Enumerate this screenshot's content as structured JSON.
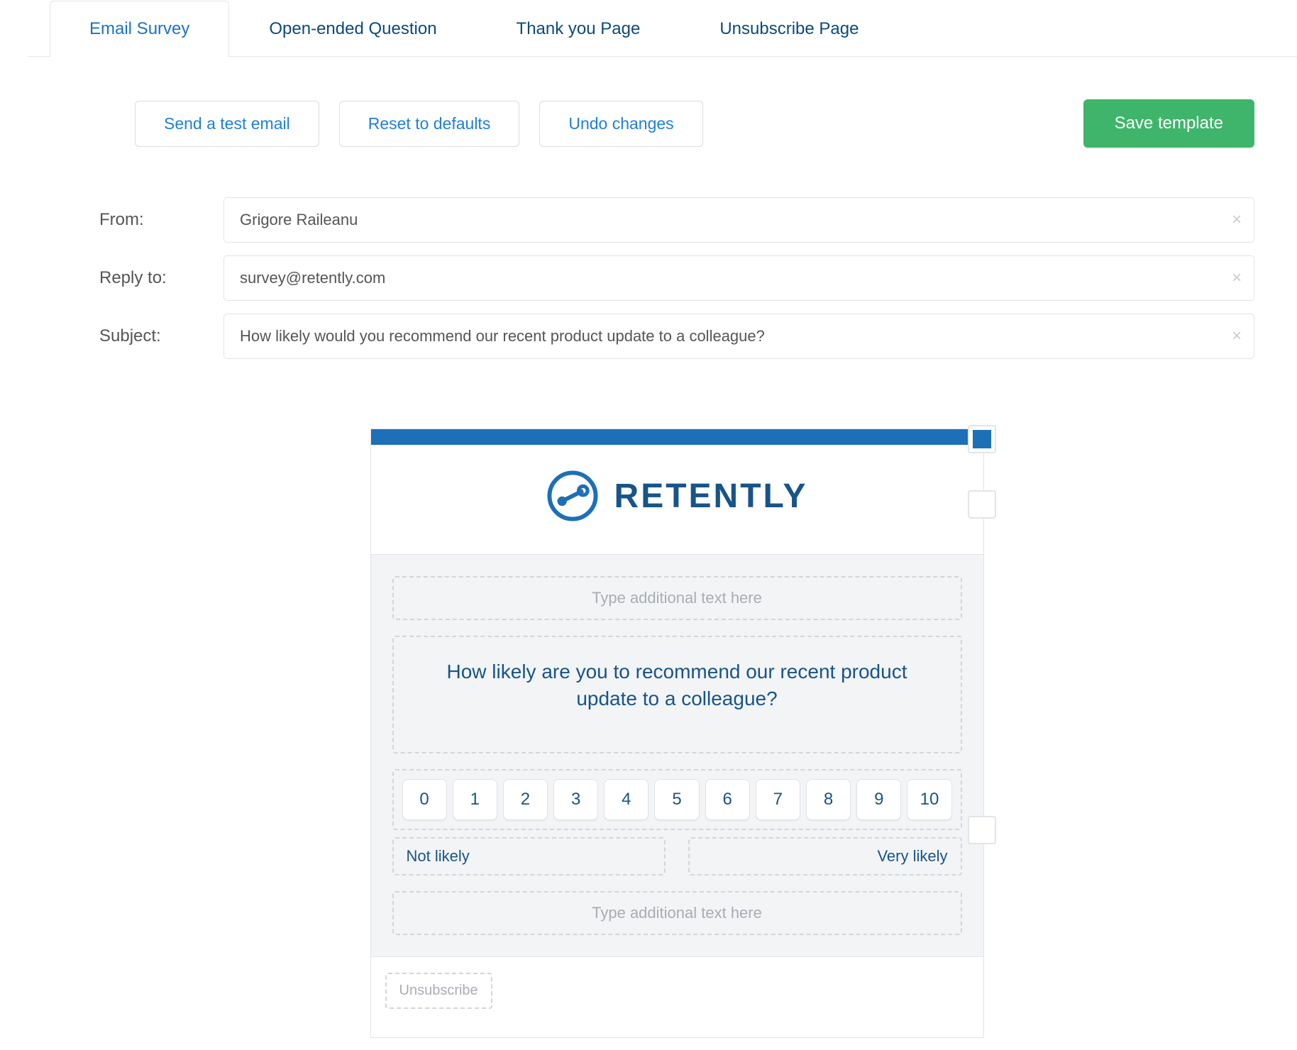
{
  "tabs": [
    {
      "label": "Email Survey",
      "active": true
    },
    {
      "label": "Open-ended Question",
      "active": false
    },
    {
      "label": "Thank you Page",
      "active": false
    },
    {
      "label": "Unsubscribe Page",
      "active": false
    }
  ],
  "toolbar": {
    "send_test": "Send a test email",
    "reset": "Reset to defaults",
    "undo": "Undo changes",
    "save": "Save template"
  },
  "form": {
    "from_label": "From:",
    "from_value": "Grigore Raileanu",
    "replyto_label": "Reply to:",
    "replyto_value": "survey@retently.com",
    "subject_label": "Subject:",
    "subject_value": "How likely would you recommend our recent product update to a colleague?"
  },
  "preview": {
    "brand_color": "#1d6fb8",
    "logo_text": "RETENTLY",
    "placeholder_top": "Type additional text here",
    "question": "How likely are you to recommend our recent product update to a colleague?",
    "scores": [
      "0",
      "1",
      "2",
      "3",
      "4",
      "5",
      "6",
      "7",
      "8",
      "9",
      "10"
    ],
    "label_low": "Not likely",
    "label_high": "Very likely",
    "placeholder_bottom": "Type additional text here",
    "unsubscribe": "Unsubscribe"
  }
}
